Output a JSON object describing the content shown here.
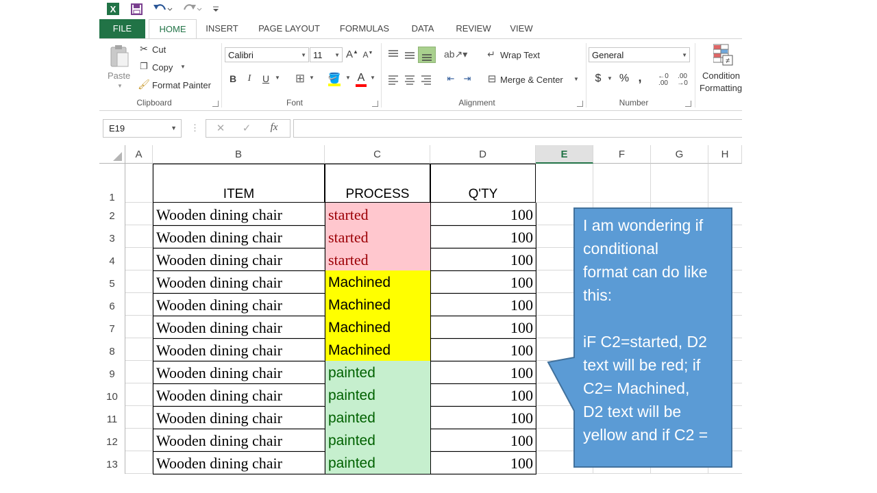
{
  "quick_access": {
    "excel_icon": "excel-logo-icon",
    "save_icon": "save-icon",
    "undo_icon": "undo-icon",
    "redo_icon": "redo-icon",
    "customize_icon": "customize-qat-icon"
  },
  "tabs": [
    {
      "label": "FILE"
    },
    {
      "label": "HOME"
    },
    {
      "label": "INSERT"
    },
    {
      "label": "PAGE LAYOUT"
    },
    {
      "label": "FORMULAS"
    },
    {
      "label": "DATA"
    },
    {
      "label": "REVIEW"
    },
    {
      "label": "VIEW"
    }
  ],
  "clipboard": {
    "paste": "Paste",
    "cut": "Cut",
    "copy": "Copy",
    "format_painter": "Format Painter",
    "group": "Clipboard"
  },
  "font": {
    "name": "Calibri",
    "size": "11",
    "bold": "B",
    "italic": "I",
    "underline": "U",
    "group": "Font",
    "fill_color": "#ffff00",
    "font_color": "#ff0000"
  },
  "alignment": {
    "wrap_text": "Wrap Text",
    "merge_center": "Merge & Center",
    "group": "Alignment"
  },
  "number": {
    "format": "General",
    "currency": "$",
    "percent": "%",
    "comma": ",",
    "inc_decimal": ".00",
    "dec_decimal": ".0",
    "group": "Number"
  },
  "styles": {
    "conditional_line1": "Condition",
    "conditional_line2": "Formatting"
  },
  "formula_bar": {
    "name_box": "E19",
    "cancel": "✕",
    "enter": "✓",
    "fx": "fx",
    "content": ""
  },
  "columns": [
    "A",
    "B",
    "C",
    "D",
    "E",
    "F",
    "G",
    "H"
  ],
  "selected_column": "E",
  "headers": {
    "row": "1",
    "item": "ITEM",
    "process": "PROCESS",
    "qty": "Q'TY"
  },
  "rows": [
    {
      "num": "2",
      "item": "Wooden dining chair",
      "process": "started",
      "qty": "100"
    },
    {
      "num": "3",
      "item": "Wooden dining chair",
      "process": "started",
      "qty": "100"
    },
    {
      "num": "4",
      "item": "Wooden dining chair",
      "process": "started",
      "qty": "100"
    },
    {
      "num": "5",
      "item": "Wooden dining chair",
      "process": "Machined",
      "qty": "100"
    },
    {
      "num": "6",
      "item": "Wooden dining chair",
      "process": "Machined",
      "qty": "100"
    },
    {
      "num": "7",
      "item": "Wooden dining chair",
      "process": "Machined",
      "qty": "100"
    },
    {
      "num": "8",
      "item": "Wooden dining chair",
      "process": "Machined",
      "qty": "100"
    },
    {
      "num": "9",
      "item": "Wooden dining chair",
      "process": "painted",
      "qty": "100"
    },
    {
      "num": "10",
      "item": "Wooden dining chair",
      "process": "painted",
      "qty": "100"
    },
    {
      "num": "11",
      "item": "Wooden dining chair",
      "process": "painted",
      "qty": "100"
    },
    {
      "num": "12",
      "item": "Wooden dining chair",
      "process": "painted",
      "qty": "100"
    },
    {
      "num": "13",
      "item": "Wooden dining chair",
      "process": "painted",
      "qty": "100"
    }
  ],
  "process_styles": {
    "started": {
      "bg": "#ffc7ce",
      "fg": "#9c0006"
    },
    "Machined": {
      "bg": "#ffff00",
      "fg": "#000000"
    },
    "painted": {
      "bg": "#c6efce",
      "fg": "#006100"
    }
  },
  "callout": {
    "lines": [
      "I am wondering if",
      "conditional",
      "format can do like",
      "this:",
      "",
      "iF C2=started, D2",
      "text will be red; if",
      "C2= Machined,",
      "D2 text will be",
      "yellow and if C2 ="
    ],
    "fill": "#5b9bd5",
    "border": "#41719c"
  },
  "colors": {
    "accent": "#217346"
  }
}
